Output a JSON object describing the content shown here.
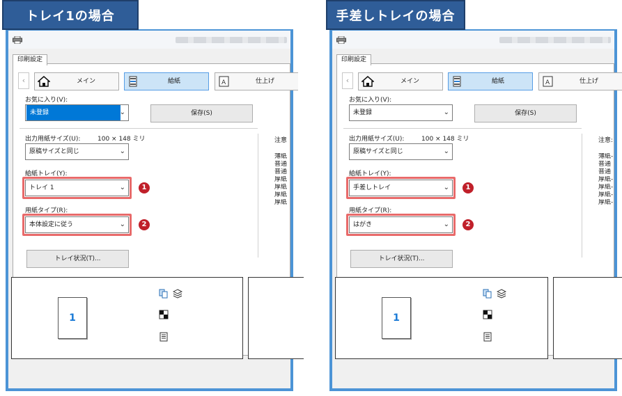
{
  "panels": [
    {
      "caption": "トレイ1の場合",
      "tab": "印刷設定",
      "nav": {
        "main": "メイン",
        "paper": "給紙",
        "finish": "仕上げ"
      },
      "favorites": {
        "label": "お気に入り(V):",
        "value": "未登録",
        "save": "保存(S)"
      },
      "output_size": {
        "label": "出力用紙サイズ(U):",
        "size": "100 × 148 ミリ",
        "value": "原稿サイズと同じ"
      },
      "tray": {
        "label": "給紙トレイ(Y):",
        "value": "トレイ 1"
      },
      "paper_type": {
        "label": "用紙タイプ(R):",
        "value": "本体設定に従う"
      },
      "tray_status": "トレイ状況(T)...",
      "markers": [
        "1",
        "2"
      ],
      "notes": {
        "title": "注意",
        "lines": [
          "薄紙",
          "普通",
          "普通",
          "厚紙",
          "厚紙",
          "厚紙",
          "厚紙"
        ]
      },
      "preview_page": "1"
    },
    {
      "caption": "手差しトレイの場合",
      "tab": "印刷設定",
      "nav": {
        "main": "メイン",
        "paper": "給紙",
        "finish": "仕上げ"
      },
      "favorites": {
        "label": "お気に入り(V):",
        "value": "未登録",
        "save": "保存(S)"
      },
      "output_size": {
        "label": "出力用紙サイズ(U):",
        "size": "100 × 148 ミリ",
        "value": "原稿サイズと同じ"
      },
      "tray": {
        "label": "給紙トレイ(Y):",
        "value": "手差しトレイ"
      },
      "paper_type": {
        "label": "用紙タイプ(R):",
        "value": "はがき"
      },
      "tray_status": "トレイ状況(T)...",
      "markers": [
        "1",
        "2"
      ],
      "notes": {
        "title": "注意:",
        "lines": [
          "薄紙-",
          "普通",
          "普通",
          "厚紙-",
          "厚紙-",
          "厚紙-",
          "厚紙-"
        ]
      },
      "preview_page": "1"
    }
  ],
  "colors": {
    "caption_bg": "#2f5d98",
    "window_border": "#4c94d6",
    "highlight": "#e86a6a",
    "marker": "#c0202a",
    "selection": "#0078d7"
  }
}
